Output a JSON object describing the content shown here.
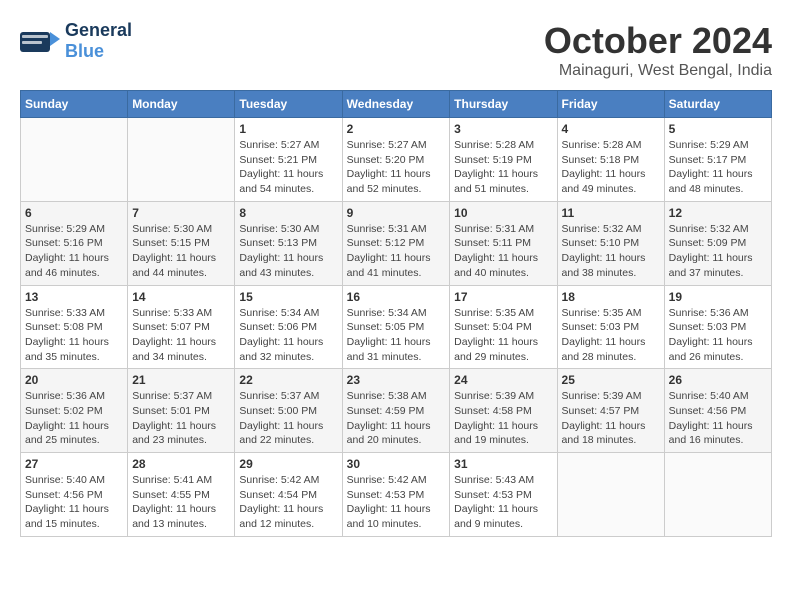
{
  "header": {
    "logo_general": "General",
    "logo_blue": "Blue",
    "month_title": "October 2024",
    "location": "Mainaguri, West Bengal, India"
  },
  "weekdays": [
    "Sunday",
    "Monday",
    "Tuesday",
    "Wednesday",
    "Thursday",
    "Friday",
    "Saturday"
  ],
  "weeks": [
    [
      {
        "day": "",
        "sunrise": "",
        "sunset": "",
        "daylight": ""
      },
      {
        "day": "",
        "sunrise": "",
        "sunset": "",
        "daylight": ""
      },
      {
        "day": "1",
        "sunrise": "Sunrise: 5:27 AM",
        "sunset": "Sunset: 5:21 PM",
        "daylight": "Daylight: 11 hours and 54 minutes."
      },
      {
        "day": "2",
        "sunrise": "Sunrise: 5:27 AM",
        "sunset": "Sunset: 5:20 PM",
        "daylight": "Daylight: 11 hours and 52 minutes."
      },
      {
        "day": "3",
        "sunrise": "Sunrise: 5:28 AM",
        "sunset": "Sunset: 5:19 PM",
        "daylight": "Daylight: 11 hours and 51 minutes."
      },
      {
        "day": "4",
        "sunrise": "Sunrise: 5:28 AM",
        "sunset": "Sunset: 5:18 PM",
        "daylight": "Daylight: 11 hours and 49 minutes."
      },
      {
        "day": "5",
        "sunrise": "Sunrise: 5:29 AM",
        "sunset": "Sunset: 5:17 PM",
        "daylight": "Daylight: 11 hours and 48 minutes."
      }
    ],
    [
      {
        "day": "6",
        "sunrise": "Sunrise: 5:29 AM",
        "sunset": "Sunset: 5:16 PM",
        "daylight": "Daylight: 11 hours and 46 minutes."
      },
      {
        "day": "7",
        "sunrise": "Sunrise: 5:30 AM",
        "sunset": "Sunset: 5:15 PM",
        "daylight": "Daylight: 11 hours and 44 minutes."
      },
      {
        "day": "8",
        "sunrise": "Sunrise: 5:30 AM",
        "sunset": "Sunset: 5:13 PM",
        "daylight": "Daylight: 11 hours and 43 minutes."
      },
      {
        "day": "9",
        "sunrise": "Sunrise: 5:31 AM",
        "sunset": "Sunset: 5:12 PM",
        "daylight": "Daylight: 11 hours and 41 minutes."
      },
      {
        "day": "10",
        "sunrise": "Sunrise: 5:31 AM",
        "sunset": "Sunset: 5:11 PM",
        "daylight": "Daylight: 11 hours and 40 minutes."
      },
      {
        "day": "11",
        "sunrise": "Sunrise: 5:32 AM",
        "sunset": "Sunset: 5:10 PM",
        "daylight": "Daylight: 11 hours and 38 minutes."
      },
      {
        "day": "12",
        "sunrise": "Sunrise: 5:32 AM",
        "sunset": "Sunset: 5:09 PM",
        "daylight": "Daylight: 11 hours and 37 minutes."
      }
    ],
    [
      {
        "day": "13",
        "sunrise": "Sunrise: 5:33 AM",
        "sunset": "Sunset: 5:08 PM",
        "daylight": "Daylight: 11 hours and 35 minutes."
      },
      {
        "day": "14",
        "sunrise": "Sunrise: 5:33 AM",
        "sunset": "Sunset: 5:07 PM",
        "daylight": "Daylight: 11 hours and 34 minutes."
      },
      {
        "day": "15",
        "sunrise": "Sunrise: 5:34 AM",
        "sunset": "Sunset: 5:06 PM",
        "daylight": "Daylight: 11 hours and 32 minutes."
      },
      {
        "day": "16",
        "sunrise": "Sunrise: 5:34 AM",
        "sunset": "Sunset: 5:05 PM",
        "daylight": "Daylight: 11 hours and 31 minutes."
      },
      {
        "day": "17",
        "sunrise": "Sunrise: 5:35 AM",
        "sunset": "Sunset: 5:04 PM",
        "daylight": "Daylight: 11 hours and 29 minutes."
      },
      {
        "day": "18",
        "sunrise": "Sunrise: 5:35 AM",
        "sunset": "Sunset: 5:03 PM",
        "daylight": "Daylight: 11 hours and 28 minutes."
      },
      {
        "day": "19",
        "sunrise": "Sunrise: 5:36 AM",
        "sunset": "Sunset: 5:03 PM",
        "daylight": "Daylight: 11 hours and 26 minutes."
      }
    ],
    [
      {
        "day": "20",
        "sunrise": "Sunrise: 5:36 AM",
        "sunset": "Sunset: 5:02 PM",
        "daylight": "Daylight: 11 hours and 25 minutes."
      },
      {
        "day": "21",
        "sunrise": "Sunrise: 5:37 AM",
        "sunset": "Sunset: 5:01 PM",
        "daylight": "Daylight: 11 hours and 23 minutes."
      },
      {
        "day": "22",
        "sunrise": "Sunrise: 5:37 AM",
        "sunset": "Sunset: 5:00 PM",
        "daylight": "Daylight: 11 hours and 22 minutes."
      },
      {
        "day": "23",
        "sunrise": "Sunrise: 5:38 AM",
        "sunset": "Sunset: 4:59 PM",
        "daylight": "Daylight: 11 hours and 20 minutes."
      },
      {
        "day": "24",
        "sunrise": "Sunrise: 5:39 AM",
        "sunset": "Sunset: 4:58 PM",
        "daylight": "Daylight: 11 hours and 19 minutes."
      },
      {
        "day": "25",
        "sunrise": "Sunrise: 5:39 AM",
        "sunset": "Sunset: 4:57 PM",
        "daylight": "Daylight: 11 hours and 18 minutes."
      },
      {
        "day": "26",
        "sunrise": "Sunrise: 5:40 AM",
        "sunset": "Sunset: 4:56 PM",
        "daylight": "Daylight: 11 hours and 16 minutes."
      }
    ],
    [
      {
        "day": "27",
        "sunrise": "Sunrise: 5:40 AM",
        "sunset": "Sunset: 4:56 PM",
        "daylight": "Daylight: 11 hours and 15 minutes."
      },
      {
        "day": "28",
        "sunrise": "Sunrise: 5:41 AM",
        "sunset": "Sunset: 4:55 PM",
        "daylight": "Daylight: 11 hours and 13 minutes."
      },
      {
        "day": "29",
        "sunrise": "Sunrise: 5:42 AM",
        "sunset": "Sunset: 4:54 PM",
        "daylight": "Daylight: 11 hours and 12 minutes."
      },
      {
        "day": "30",
        "sunrise": "Sunrise: 5:42 AM",
        "sunset": "Sunset: 4:53 PM",
        "daylight": "Daylight: 11 hours and 10 minutes."
      },
      {
        "day": "31",
        "sunrise": "Sunrise: 5:43 AM",
        "sunset": "Sunset: 4:53 PM",
        "daylight": "Daylight: 11 hours and 9 minutes."
      },
      {
        "day": "",
        "sunrise": "",
        "sunset": "",
        "daylight": ""
      },
      {
        "day": "",
        "sunrise": "",
        "sunset": "",
        "daylight": ""
      }
    ]
  ]
}
